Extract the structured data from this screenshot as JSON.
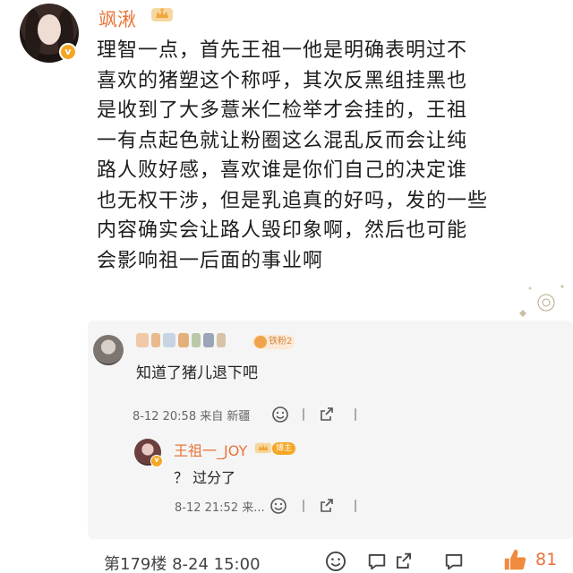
{
  "post": {
    "username": "飒湫",
    "lines": [
      "理智一点，首先王祖一他是明确表明过不",
      "喜欢的猪塑这个称呼，其次反黑组挂黑也",
      "是收到了大多薏米仁检举才会挂的，王祖",
      "一有点起色就让粉圈这么混乱反而会让纯",
      "路人败好感，喜欢谁是你们自己的决定谁",
      "也无权干涉，但是乳追真的好吗，发的一些",
      "内容确实会让路人毁印象啊，然后也可能",
      "会影响祖一后面的事业啊"
    ],
    "verified_mark": "v"
  },
  "reply1": {
    "badge": "铁粉2",
    "text": "知道了猪儿退下吧",
    "meta": "8-12 20:58  来自 新疆"
  },
  "reply2": {
    "username": "王祖一_JOY",
    "badge": "博主",
    "text": "？ 过分了",
    "meta": "8-12 21:52  来...",
    "verified_mark": "v"
  },
  "footer": {
    "floor": "第179楼  8-24 15:00",
    "like_count": "81"
  },
  "colors": {
    "accent": "#e8743a",
    "badge_gold": "#f5a623",
    "reply_bg": "#f5f5f5"
  },
  "icons": [
    "crown-icon",
    "smile-icon",
    "comment-icon",
    "share-icon",
    "thumbs-up-icon"
  ]
}
